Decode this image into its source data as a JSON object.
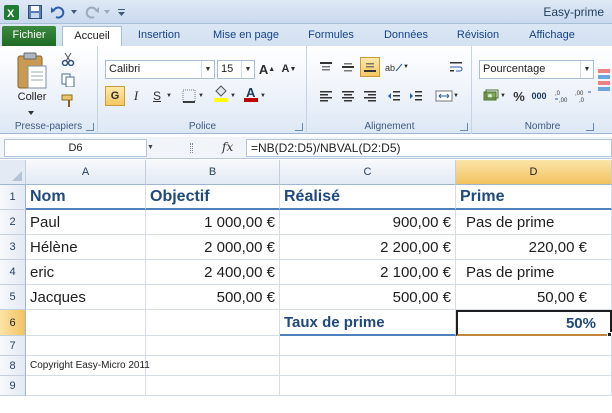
{
  "window": {
    "title": "Easy-prime",
    "qat": [
      "save-icon",
      "undo-icon",
      "redo-icon"
    ]
  },
  "tabs": [
    "Fichier",
    "Accueil",
    "Insertion",
    "Mise en page",
    "Formules",
    "Données",
    "Révision",
    "Affichage"
  ],
  "ribbon": {
    "clipboard": {
      "label": "Presse-papiers",
      "paste_label": "Coller"
    },
    "font": {
      "label": "Police",
      "font_name": "Calibri",
      "font_size": "15",
      "font_color": "#c00000",
      "fill_color": "#ffff00"
    },
    "alignment": {
      "label": "Alignement"
    },
    "number": {
      "label": "Nombre",
      "format": "Pourcentage"
    }
  },
  "formula_bar": {
    "name_box": "D6",
    "fx": "fx",
    "formula": "=NB(D2:D5)/NBVAL(D2:D5)"
  },
  "sheet": {
    "columns": [
      "A",
      "B",
      "C",
      "D"
    ],
    "rows": [
      "1",
      "2",
      "3",
      "4",
      "5",
      "6",
      "7",
      "8",
      "9"
    ],
    "active_cell": "D6",
    "header_color": "#1f497d",
    "cells": {
      "A1": "Nom",
      "B1": "Objectif",
      "C1": "Réalisé",
      "D1": "Prime",
      "A2": "Paul",
      "B2": "1 000,00 €",
      "C2": "900,00 €",
      "D2": "Pas de prime",
      "A3": "Hélène",
      "B3": "2 000,00 €",
      "C3": "2 200,00 €",
      "D3": "220,00 €",
      "A4": "eric",
      "B4": "2 400,00 €",
      "C4": "2 100,00 €",
      "D4": "Pas de prime",
      "A5": "Jacques",
      "B5": "500,00 €",
      "C5": "500,00 €",
      "D5": "50,00 €",
      "C6": "Taux de prime",
      "D6": "50%",
      "A8": "Copyright Easy-Micro 2011"
    }
  }
}
